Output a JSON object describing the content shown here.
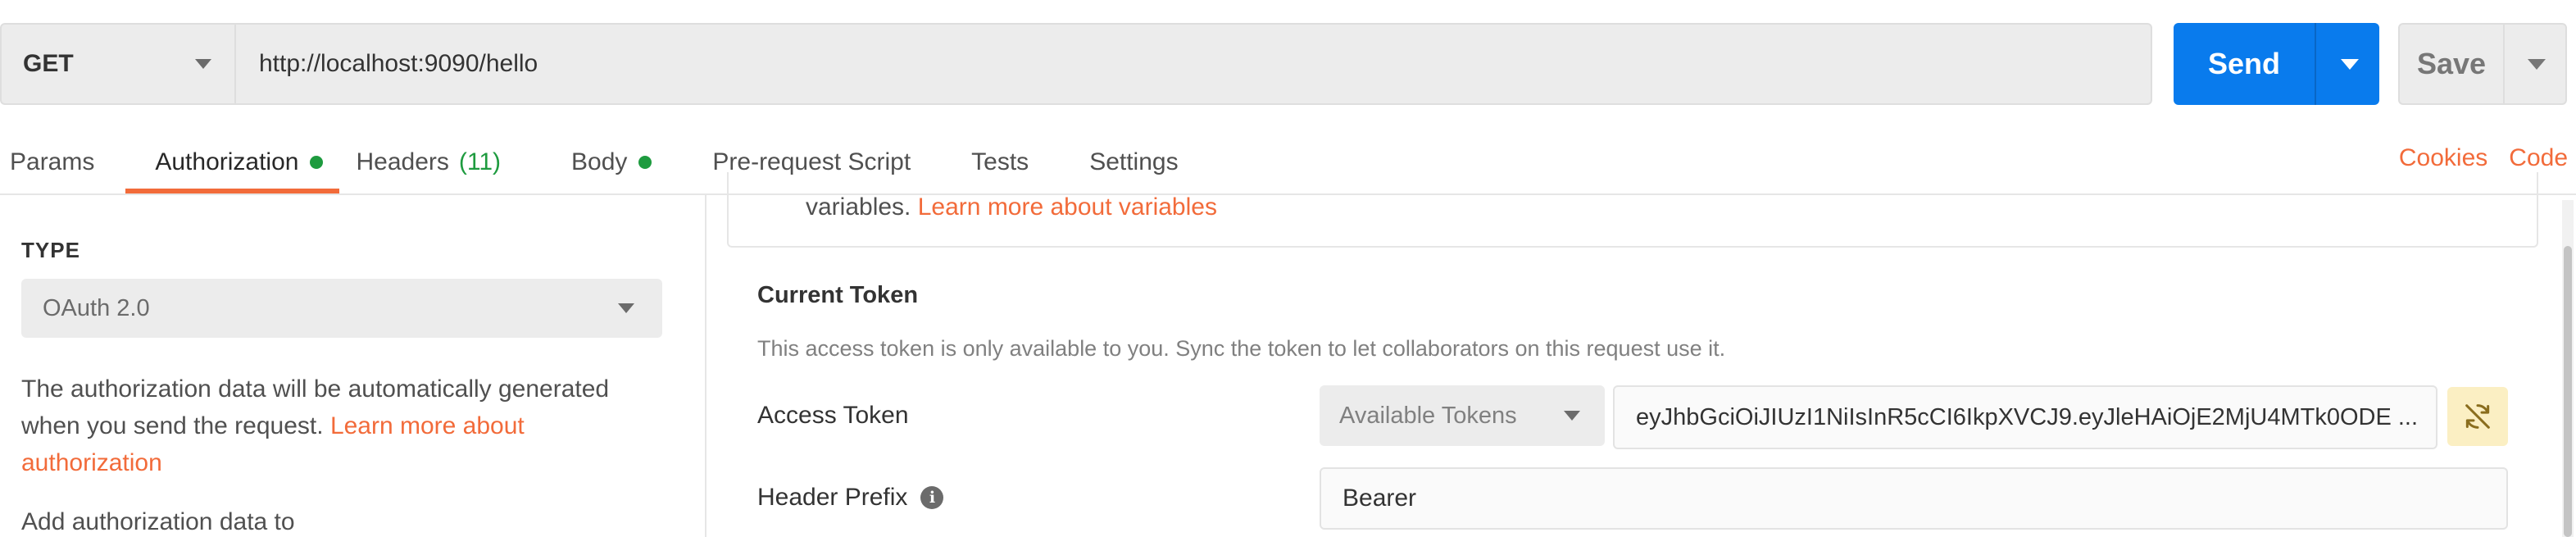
{
  "request": {
    "method": "GET",
    "url": "http://localhost:9090/hello",
    "send_label": "Send",
    "save_label": "Save"
  },
  "tabs": [
    {
      "label": "Params"
    },
    {
      "label": "Authorization",
      "active": true,
      "indicator": "dot"
    },
    {
      "label": "Headers",
      "count": "(11)"
    },
    {
      "label": "Body",
      "indicator": "dot"
    },
    {
      "label": "Pre-request Script"
    },
    {
      "label": "Tests"
    },
    {
      "label": "Settings"
    }
  ],
  "top_links": {
    "cookies": "Cookies",
    "code": "Code"
  },
  "left_pane": {
    "type_label": "TYPE",
    "type_value": "OAuth 2.0",
    "desc_text": "The authorization data will be automatically generated when you send the request.",
    "desc_link": "Learn more about authorization",
    "add_auth_label": "Add authorization data to"
  },
  "right_pane": {
    "info_text": "variables.",
    "info_link": "Learn more about variables",
    "current_token_title": "Current Token",
    "token_note": "This access token is only available to you. Sync the token to let collaborators on this request use it.",
    "access_token_label": "Access Token",
    "available_tokens_label": "Available Tokens",
    "access_token_value": "eyJhbGciOiJIUzI1NiIsInR5cCI6IkpXVCJ9.eyJleHAiOjE2MjU4MTk0ODE ...",
    "header_prefix_label": "Header Prefix",
    "header_prefix_value": "Bearer"
  },
  "colors": {
    "accent": "#f26b3a",
    "send": "#097bed",
    "indicator": "#1e9b3f",
    "sync_button": "#fbefc3"
  },
  "icons": {
    "method_dropdown": "chevron-down-icon",
    "sync": "sync-off-icon",
    "info": "info-icon"
  }
}
